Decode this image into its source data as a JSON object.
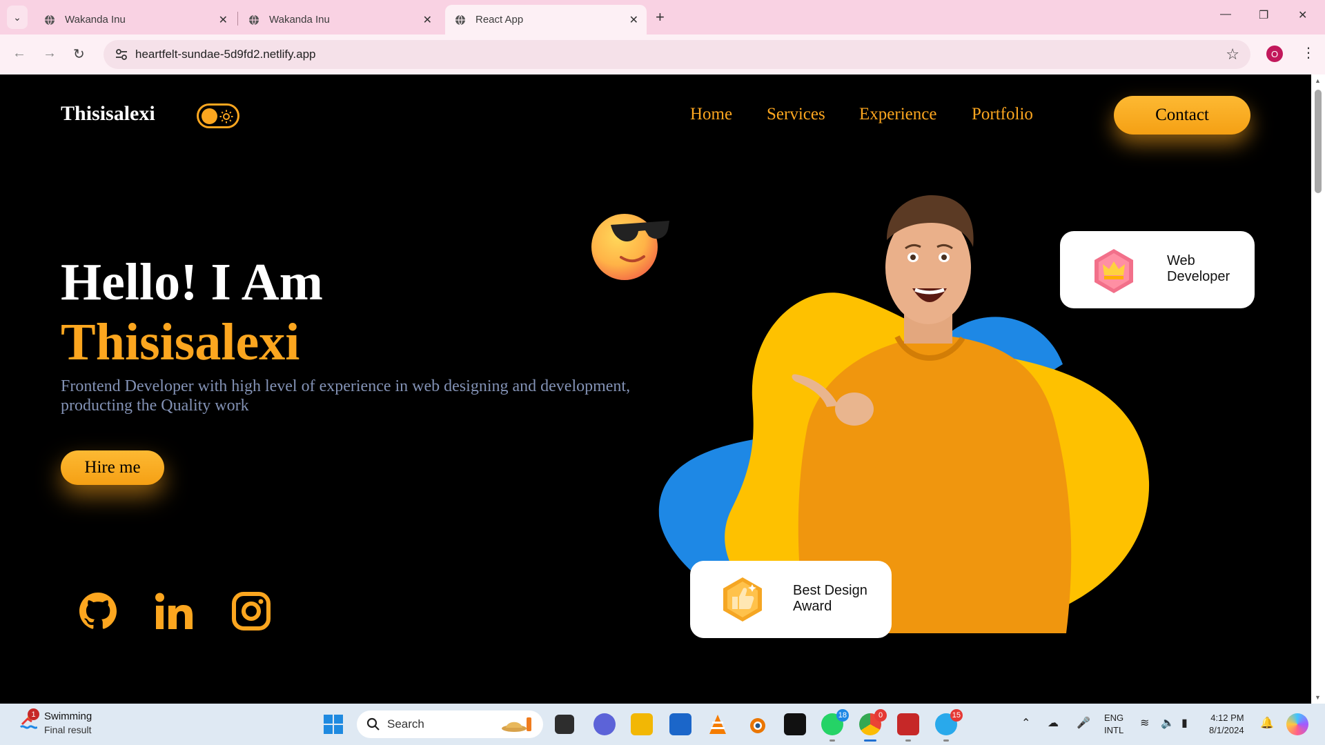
{
  "browser": {
    "tabs": [
      {
        "title": "Wakanda Inu",
        "active": false
      },
      {
        "title": "Wakanda Inu",
        "active": false
      },
      {
        "title": "React App",
        "active": true
      }
    ],
    "url": "heartfelt-sundae-5d9fd2.netlify.app",
    "profile_initial": "O"
  },
  "site": {
    "brand": "Thisisalexi",
    "nav": [
      "Home",
      "Services",
      "Experience",
      "Portfolio"
    ],
    "contact_label": "Contact",
    "hero": {
      "greeting": "Hello! I Am",
      "name": "Thisisalexi",
      "description": "Frontend Developer with high level of experience in web designing and development, producting the Quality work",
      "cta_label": "Hire me"
    },
    "social": [
      "github-icon",
      "linkedin-icon",
      "instagram-icon"
    ],
    "cards": {
      "web_developer": [
        "Web",
        "Developer"
      ],
      "award": [
        "Best Design",
        "Award"
      ]
    },
    "colors": {
      "accent": "#fca61f",
      "blob_blue": "#1e88e5",
      "blob_yellow": "#fec100",
      "description": "#8392b5"
    }
  },
  "taskbar": {
    "weather_title": "Swimming",
    "weather_subtitle": "Final result",
    "weather_badge": "1",
    "search_placeholder": "Search",
    "whatsapp_badge": "18",
    "chrome_badge": "0",
    "telegram_badge": "15",
    "lang_line1": "ENG",
    "lang_line2": "INTL",
    "time": "4:12 PM",
    "date": "8/1/2024"
  }
}
